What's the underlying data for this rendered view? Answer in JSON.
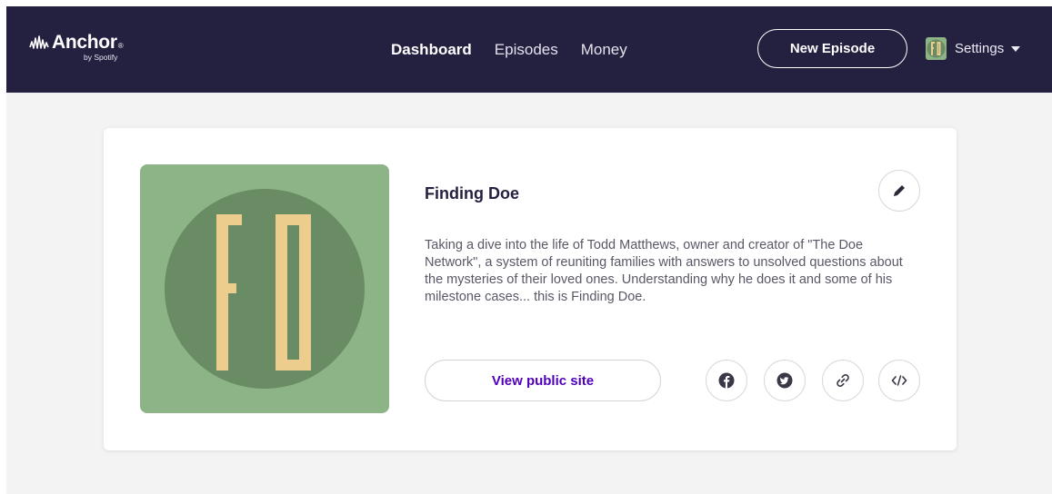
{
  "header": {
    "logo": {
      "name": "Anchor",
      "registered": "®",
      "subtitle": "by Spotify"
    },
    "nav": [
      {
        "label": "Dashboard",
        "active": true
      },
      {
        "label": "Episodes",
        "active": false
      },
      {
        "label": "Money",
        "active": false
      }
    ],
    "new_episode_label": "New Episode",
    "settings_label": "Settings"
  },
  "podcast": {
    "title": "Finding Doe",
    "description": "Taking a dive into the life of Todd Matthews, owner and creator of \"The Doe Network\", a system of reuniting families with answers to unsolved questions about the mysteries of their loved ones. Understanding why he does it and some of his milestone cases... this is Finding Doe.",
    "cover_initials": "FD",
    "view_public_site_label": "View public site",
    "share_icons": [
      "facebook-icon",
      "twitter-icon",
      "link-icon",
      "embed-icon"
    ]
  },
  "colors": {
    "header_bg": "#24203f",
    "page_bg": "#f3f3f4",
    "accent_purple": "#5000b9",
    "cover_bg": "#8db486",
    "cover_circle": "#6a8c65",
    "cover_letters": "#eccd8e"
  }
}
